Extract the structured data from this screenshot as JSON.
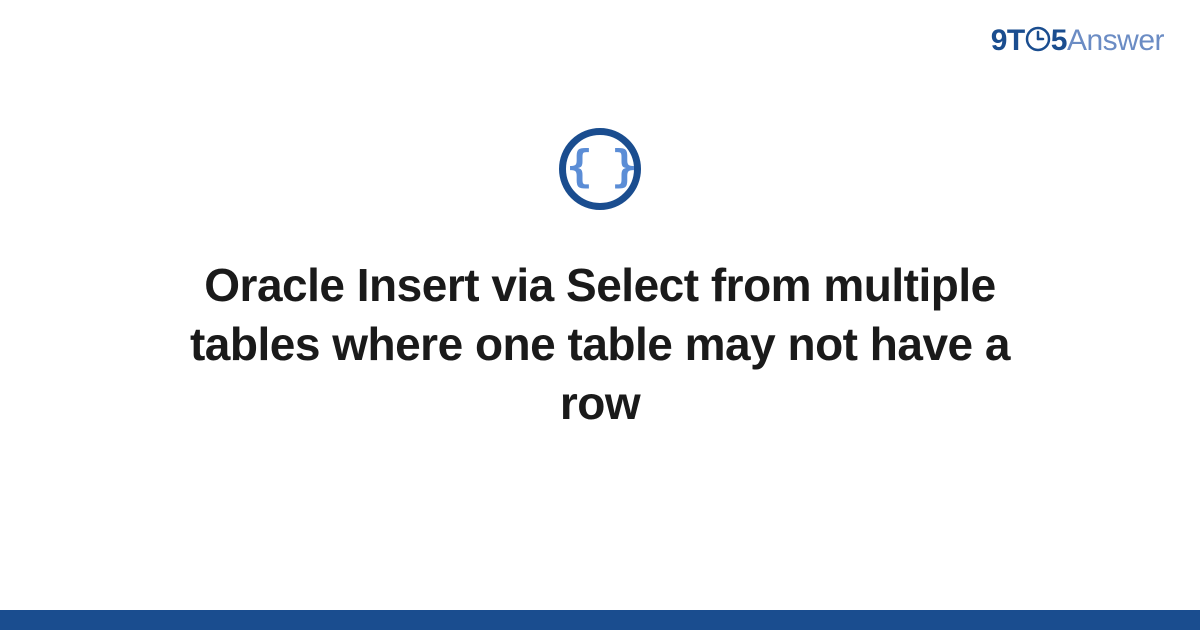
{
  "brand": {
    "part1": "9T",
    "part2": "5",
    "part3": "Answer"
  },
  "badge": {
    "symbol": "{ }"
  },
  "heading": "Oracle Insert via Select from multiple tables where one table may not have a row",
  "colors": {
    "primary": "#1a4d8f",
    "secondary": "#6b8cc4",
    "accent": "#5b8dd6"
  }
}
